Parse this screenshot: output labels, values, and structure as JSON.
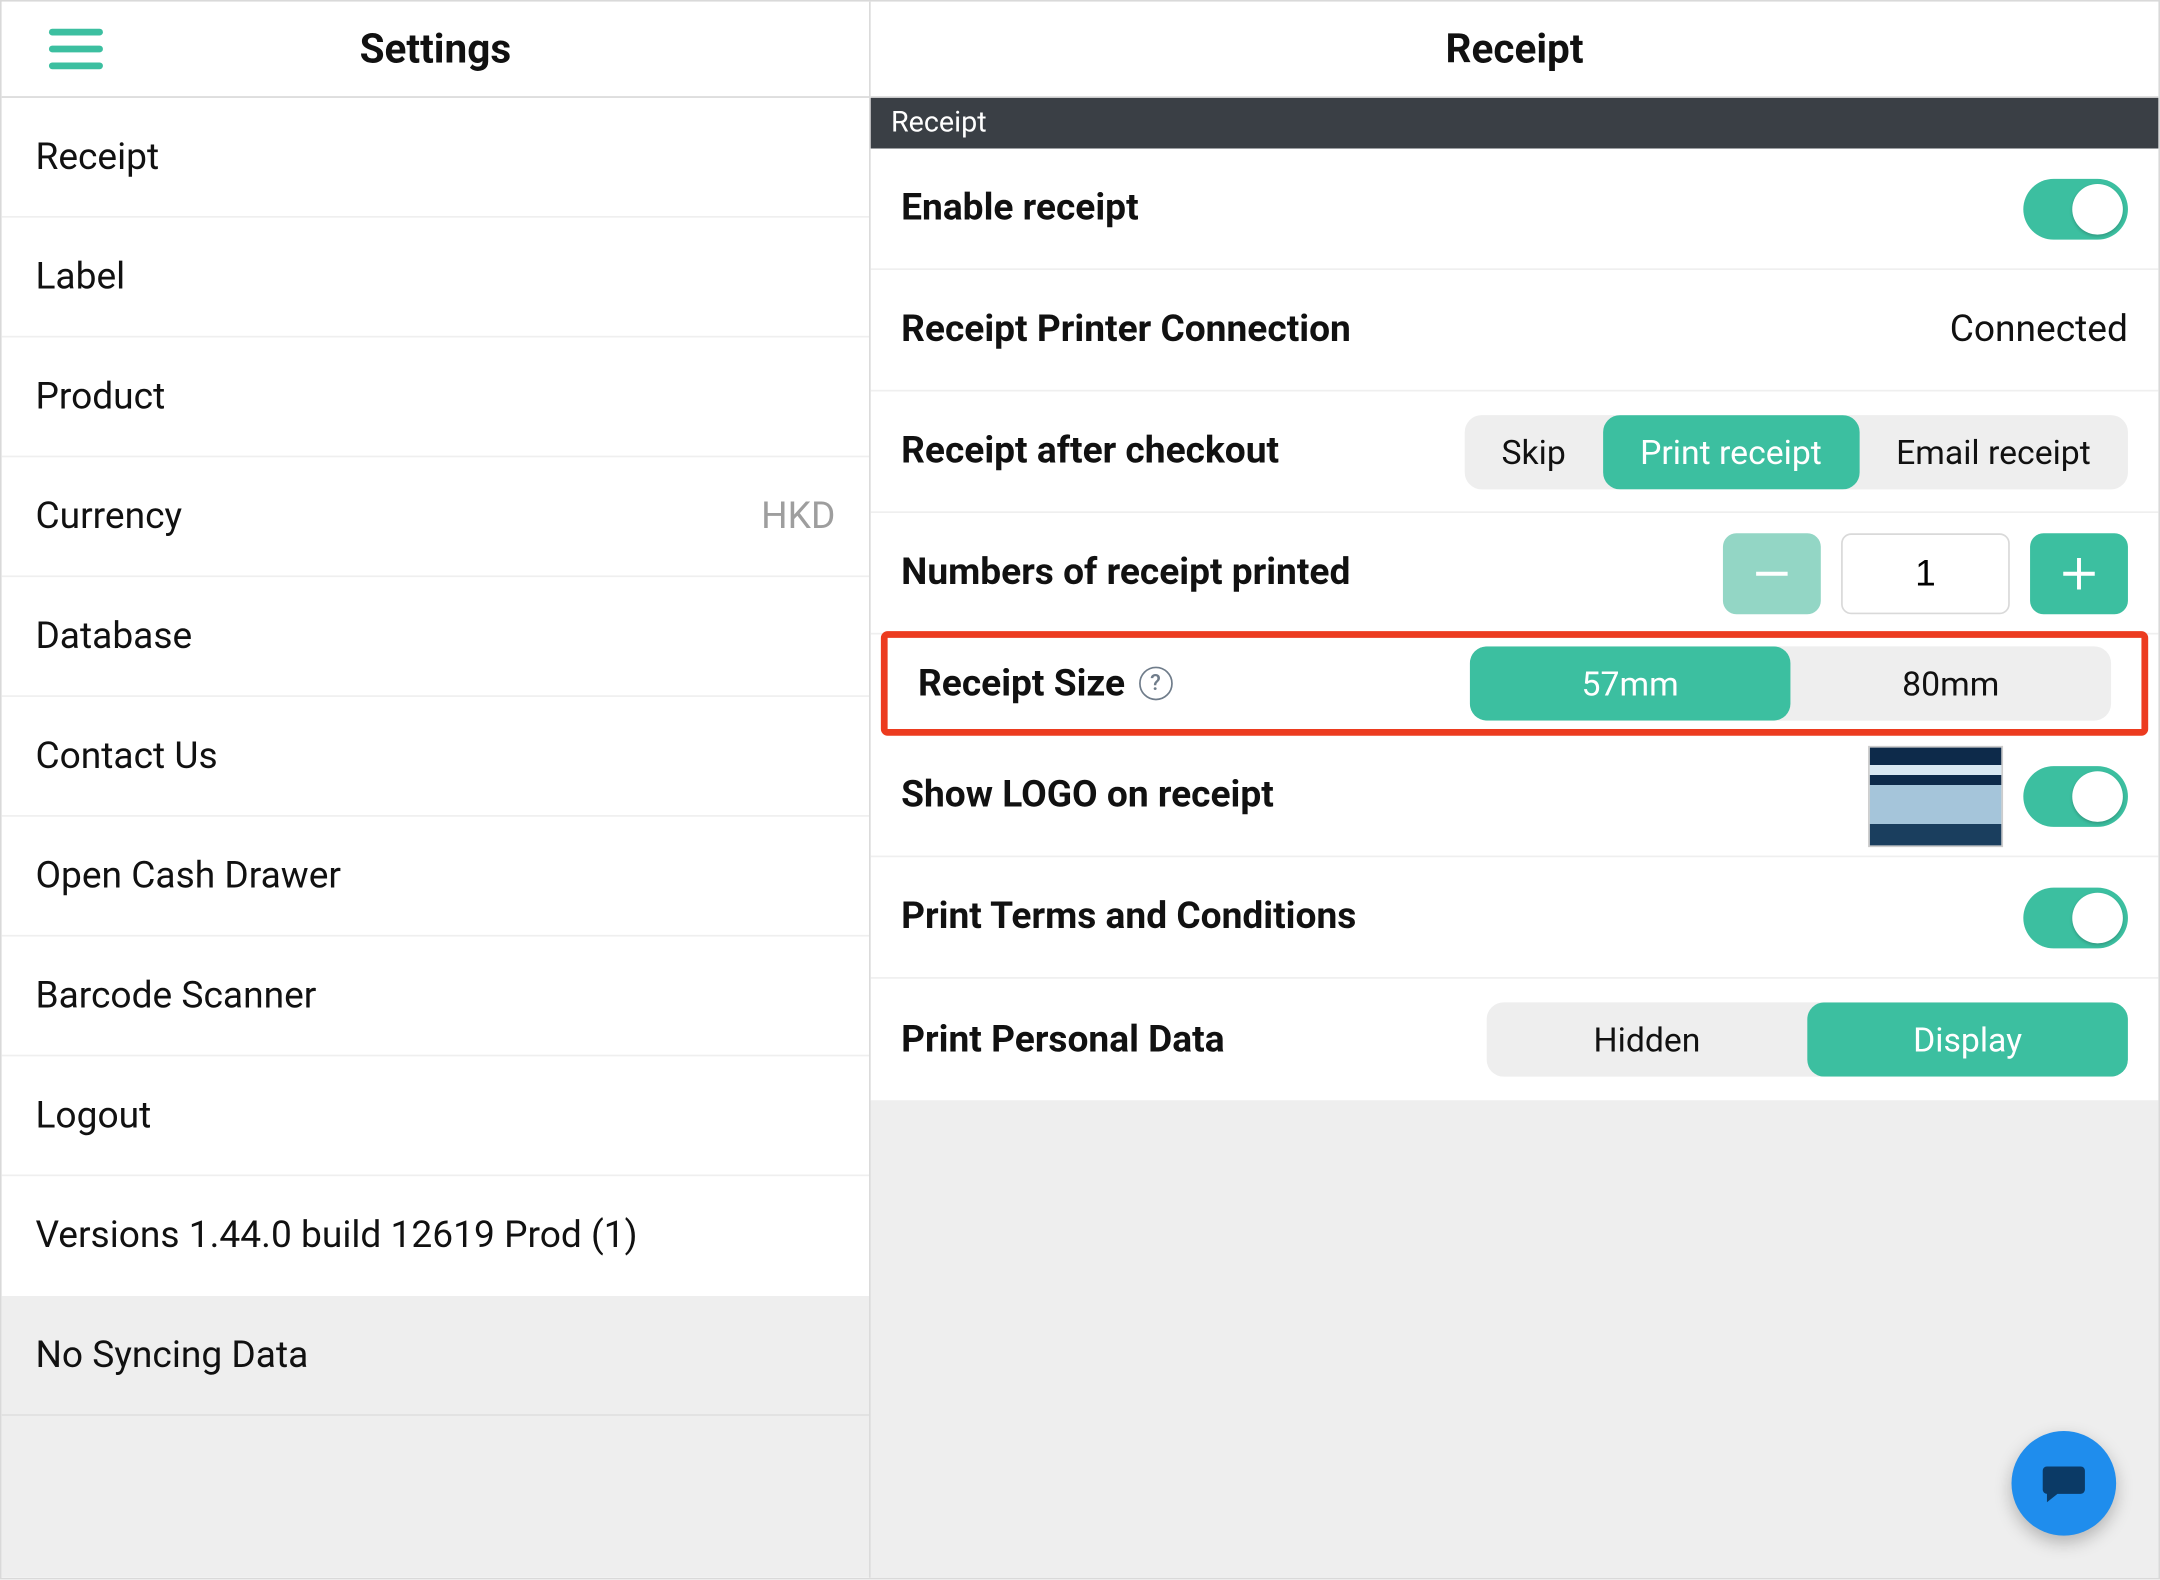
{
  "left": {
    "title": "Settings",
    "items": [
      {
        "label": "Receipt"
      },
      {
        "label": "Label"
      },
      {
        "label": "Product"
      },
      {
        "label": "Currency",
        "value": "HKD"
      },
      {
        "label": "Database"
      },
      {
        "label": "Contact Us"
      },
      {
        "label": "Open Cash Drawer"
      },
      {
        "label": "Barcode Scanner"
      },
      {
        "label": "Logout"
      }
    ],
    "version_line": "Versions 1.44.0   build 12619    Prod  (1)",
    "sync_status": "No Syncing Data"
  },
  "right": {
    "title": "Receipt",
    "section_label": "Receipt",
    "enable_receipt": {
      "label": "Enable receipt",
      "on": true
    },
    "printer": {
      "label": "Receipt Printer Connection",
      "value": "Connected"
    },
    "after_checkout": {
      "label": "Receipt after checkout",
      "options": [
        "Skip",
        "Print receipt",
        "Email receipt"
      ],
      "active": 1
    },
    "num_printed": {
      "label": "Numbers of receipt printed",
      "value": "1"
    },
    "size": {
      "label": "Receipt Size",
      "options": [
        "57mm",
        "80mm"
      ],
      "active": 0
    },
    "show_logo": {
      "label": "Show LOGO on receipt",
      "on": true
    },
    "print_terms": {
      "label": "Print Terms and Conditions",
      "on": true
    },
    "personal_data": {
      "label": "Print Personal Data",
      "options": [
        "Hidden",
        "Display"
      ],
      "active": 1
    }
  }
}
